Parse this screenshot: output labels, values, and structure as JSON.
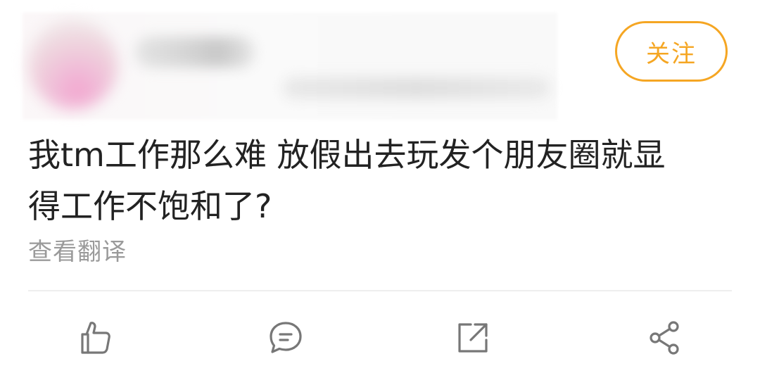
{
  "header": {
    "avatar_icon": "avatar-blurred",
    "follow_label": "关注"
  },
  "post": {
    "text_line1": "我tm工作那么难 放假出去玩发个朋友圈就显",
    "text_line2": "得工作不饱和了?",
    "translate_label": "查看翻译"
  },
  "actions": {
    "like_icon": "thumbs-up-icon",
    "comment_icon": "comment-bubble-icon",
    "repost_icon": "external-share-icon",
    "share_icon": "share-nodes-icon"
  },
  "colors": {
    "accent": "#f5a623",
    "text": "#222222",
    "muted": "#9a9a9a",
    "icon": "#777777",
    "divider": "#eeeeee"
  }
}
